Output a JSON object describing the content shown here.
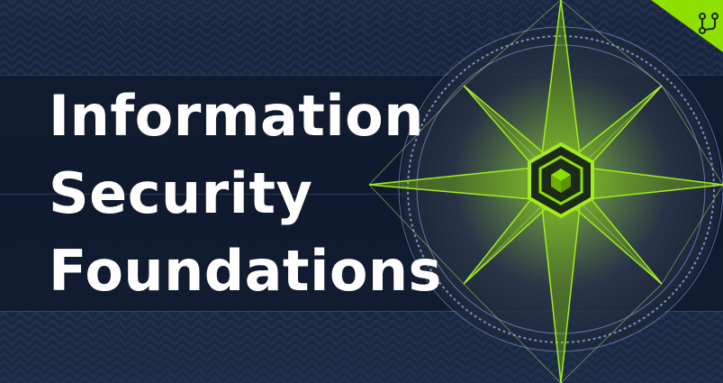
{
  "title": {
    "line1": "Information",
    "line2": "Security",
    "line3": "Foundations"
  },
  "icons": {
    "corner": "route-icon",
    "emblem": "cube-icon"
  },
  "colors": {
    "background": "#15223a",
    "accent": "#8ee000",
    "text": "#ffffff",
    "mesh": "#8fa6e6"
  }
}
